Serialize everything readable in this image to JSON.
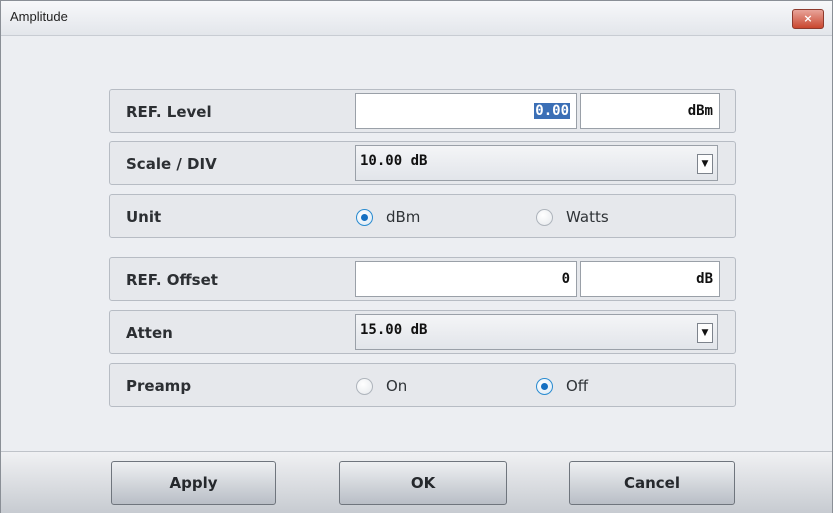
{
  "window": {
    "title": "Amplitude",
    "close_icon": "×"
  },
  "rows": {
    "ref_level": {
      "label": "REF. Level",
      "value": "0.00",
      "unit": "dBm"
    },
    "scale_div": {
      "label": "Scale / DIV",
      "value": "10.00 dB"
    },
    "unit": {
      "label": "Unit",
      "options": [
        "dBm",
        "Watts"
      ],
      "selected": "dBm"
    },
    "ref_offset": {
      "label": "REF. Offset",
      "value": "0",
      "unit": "dB"
    },
    "atten": {
      "label": "Atten",
      "value": "15.00 dB"
    },
    "preamp": {
      "label": "Preamp",
      "options": [
        "On",
        "Off"
      ],
      "selected": "Off"
    }
  },
  "dropdown_icon": "▼",
  "buttons": {
    "apply": "Apply",
    "ok": "OK",
    "cancel": "Cancel"
  },
  "colors": {
    "radio_selected": "#1570c2",
    "selection_highlight": "#3b6fb6",
    "close_button": "#c9472f"
  }
}
